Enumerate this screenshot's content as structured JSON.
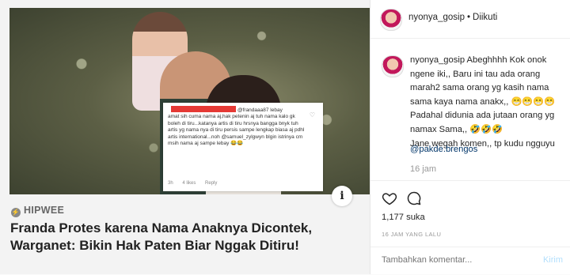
{
  "post": {
    "image": {
      "comment_card": {
        "handle": "@frandaaa87 lebay",
        "text": "amat sih cuma nama aj,hak petenin aj tuh nama kalo gk boleh di tiru...katanya artis di tiru hrsnya bangga bnyk tuh artis yg nama nya di tiru persis sampe lengkap biasa aj pdhl artis international...noh @samuel_zylgwyn blgin istrinya cm msih nama aj sampe lebay",
        "emoji": "😂😂",
        "time": "3h",
        "likes": "4 likes",
        "reply": "Reply"
      },
      "info_label": "i",
      "source": "HIPWEE",
      "headline": "Franda Protes karena Nama Anaknya Dicontek, Warganet: Bikin Hak Paten Biar Nggak Ditiru!"
    }
  },
  "header": {
    "username": "nyonya_gosip",
    "separator": "•",
    "follow_status": "Diikuti"
  },
  "caption": {
    "username": "nyonya_gosip",
    "lines": [
      "Abeghhhh Kok onok ngene iki,, Baru ini tau ada orang marah2 sama orang yg kasih nama sama kaya nama anakx,, 😁😁😁😁",
      "Padahal didunia ada jutaan orang yg namax Sama,, 🤣🤣🤣",
      "Jane wegah komen,, tp kudu ngguyu"
    ],
    "mention": "@pakde.brengos",
    "time": "16 jam"
  },
  "stats": {
    "likes": "1,177 suka",
    "date": "16 JAM YANG LALU"
  },
  "add_comment": {
    "placeholder": "Tambahkan komentar...",
    "post_label": "Kirim"
  },
  "colors": {
    "link": "#003569",
    "muted": "#999999",
    "post_disabled": "#b2dffc",
    "redaction": "#e53935"
  },
  "icons": [
    "info-icon",
    "source-bolt-icon",
    "heart-icon",
    "comment-bubble-icon",
    "heart-outline-icon"
  ]
}
